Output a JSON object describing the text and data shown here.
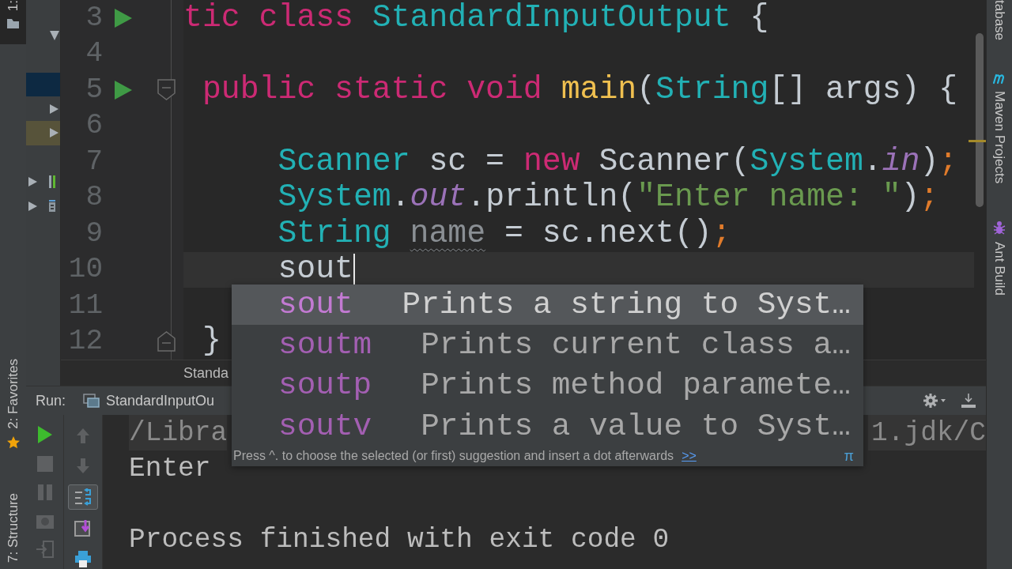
{
  "left_tool_windows": [
    {
      "label": "1:",
      "kind": "folder",
      "selected": true
    },
    {
      "label": "2: Favorites",
      "kind": "star",
      "selected": false
    },
    {
      "label": "7: Structure",
      "kind": "plain",
      "selected": false
    }
  ],
  "project_tree": {
    "rows": [
      {
        "kind": "folder",
        "expanded": true,
        "selected": false,
        "highlighted": false
      },
      {
        "kind": "leaf",
        "selected": true,
        "highlighted": false
      },
      {
        "kind": "folder",
        "expanded": false,
        "selected": false,
        "highlighted": false
      },
      {
        "kind": "folder",
        "expanded": false,
        "selected": false,
        "highlighted": true
      }
    ],
    "roots": [
      {
        "kind": "module",
        "expanded": false
      },
      {
        "kind": "library",
        "expanded": false
      }
    ]
  },
  "editor": {
    "lines": [
      {
        "number": "3",
        "kind": "class",
        "runnable": true,
        "fold_open": false,
        "fold_close": false,
        "current": false,
        "tokens": [
          {
            "kind": "keyword",
            "text": "tic class"
          },
          {
            "kind": "type",
            "text": " StandardInputOutput"
          },
          {
            "kind": "plain",
            "text": " {"
          }
        ]
      },
      {
        "number": "4",
        "runnable": false,
        "fold_open": false,
        "fold_close": false,
        "current": false
      },
      {
        "number": "5",
        "kind": "member",
        "runnable": true,
        "fold_open": true,
        "fold_close": false,
        "current": false,
        "tokens": [
          {
            "kind": "keyword",
            "text": "public static void"
          },
          {
            "kind": "method",
            "text": " main"
          },
          {
            "kind": "plain",
            "text": "("
          },
          {
            "kind": "type",
            "text": "String"
          },
          {
            "kind": "plain",
            "text": "[] args) {"
          }
        ]
      },
      {
        "number": "6",
        "runnable": false,
        "fold_open": false,
        "fold_close": false,
        "current": false
      },
      {
        "number": "7",
        "kind": "statement",
        "runnable": false,
        "fold_open": false,
        "fold_close": false,
        "current": false,
        "tokens": [
          {
            "kind": "type",
            "text": "Scanner"
          },
          {
            "kind": "plain",
            "text": " sc = "
          },
          {
            "kind": "keyword",
            "text": "new"
          },
          {
            "kind": "plain",
            "text": " Scanner("
          },
          {
            "kind": "type",
            "text": "System"
          },
          {
            "kind": "plain",
            "text": "."
          },
          {
            "kind": "field",
            "text": "in"
          },
          {
            "kind": "plain",
            "text": ")"
          },
          {
            "kind": "semicolon",
            "text": ";"
          }
        ]
      },
      {
        "number": "8",
        "kind": "statement",
        "runnable": false,
        "fold_open": false,
        "fold_close": false,
        "current": false,
        "tokens": [
          {
            "kind": "type",
            "text": "System"
          },
          {
            "kind": "plain",
            "text": "."
          },
          {
            "kind": "field",
            "text": "out"
          },
          {
            "kind": "plain",
            "text": ".println("
          },
          {
            "kind": "string",
            "text": "\"Enter name: \""
          },
          {
            "kind": "plain",
            "text": ")"
          },
          {
            "kind": "semicolon",
            "text": ";"
          }
        ]
      },
      {
        "number": "9",
        "kind": "statement",
        "runnable": false,
        "fold_open": false,
        "fold_close": false,
        "current": false,
        "tokens": [
          {
            "kind": "type",
            "text": "String "
          },
          {
            "kind": "unused",
            "text": "name"
          },
          {
            "kind": "plain",
            "text": " = sc.next()"
          },
          {
            "kind": "semicolon",
            "text": ";"
          }
        ]
      },
      {
        "number": "10",
        "kind": "statement",
        "runnable": false,
        "fold_open": false,
        "fold_close": false,
        "current": true,
        "tokens": [
          {
            "kind": "plain",
            "text": "sout"
          }
        ]
      },
      {
        "number": "11",
        "runnable": false,
        "fold_open": false,
        "fold_close": false,
        "current": false
      },
      {
        "number": "12",
        "kind": "member",
        "runnable": false,
        "fold_open": false,
        "fold_close": true,
        "current": false,
        "tokens": [
          {
            "kind": "plain",
            "text": "}"
          }
        ]
      }
    ]
  },
  "completion": {
    "items": [
      {
        "abbreviation": "sout",
        "description": "Prints a string to Syst…",
        "selected": true
      },
      {
        "abbreviation": "soutm",
        "description": "Prints current class a…",
        "selected": false
      },
      {
        "abbreviation": "soutp",
        "description": "Prints method paramete…",
        "selected": false
      },
      {
        "abbreviation": "soutv",
        "description": "Prints a value to Syst…",
        "selected": false
      }
    ],
    "hint": "Press ^. to choose the selected (or first) suggestion and insert a dot afterwards",
    "link": ">>",
    "symbol": "π"
  },
  "breadcrumb": "Standa",
  "run_panel": {
    "label": "Run:",
    "tab": "StandardInputOu",
    "toolbar": [
      {
        "selected": false
      },
      {
        "selected": false
      },
      {
        "selected": true
      },
      {
        "selected": false
      },
      {
        "selected": false
      }
    ],
    "console": [
      {
        "kind": "command",
        "text": "/Libra",
        "tail": "1.jdk/C"
      },
      {
        "kind": "output",
        "text": "Enter"
      },
      {
        "kind": "exit",
        "text": "Process finished with exit code 0"
      }
    ]
  },
  "right_tool_windows": [
    {
      "label": "tabase",
      "kind": "plain"
    },
    {
      "label": "Maven Projects",
      "kind": "maven"
    },
    {
      "label": "Ant Build",
      "kind": "ant"
    }
  ]
}
